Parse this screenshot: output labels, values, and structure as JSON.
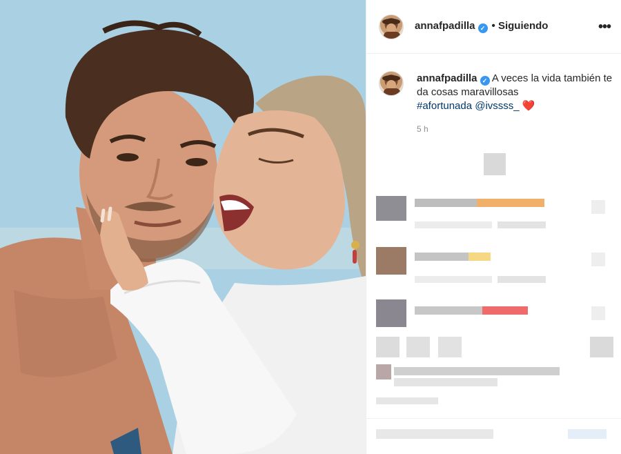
{
  "post": {
    "username": "annafpadilla",
    "verified_mark": "✓",
    "follow_status": "• Siguiendo",
    "more_icon": "•••",
    "caption_text": "A veces la vida también te da cosas maravillosas",
    "hashtag": "#afortunada",
    "mention": "@ivssss_",
    "heart": "❤️",
    "time_ago": "5 h"
  },
  "colors": {
    "verified": "#3897f0",
    "link": "#00376b",
    "meta": "#8e8e8e"
  },
  "icons": [
    "more-options-icon",
    "verified-badge-icon",
    "heart-emoji"
  ]
}
